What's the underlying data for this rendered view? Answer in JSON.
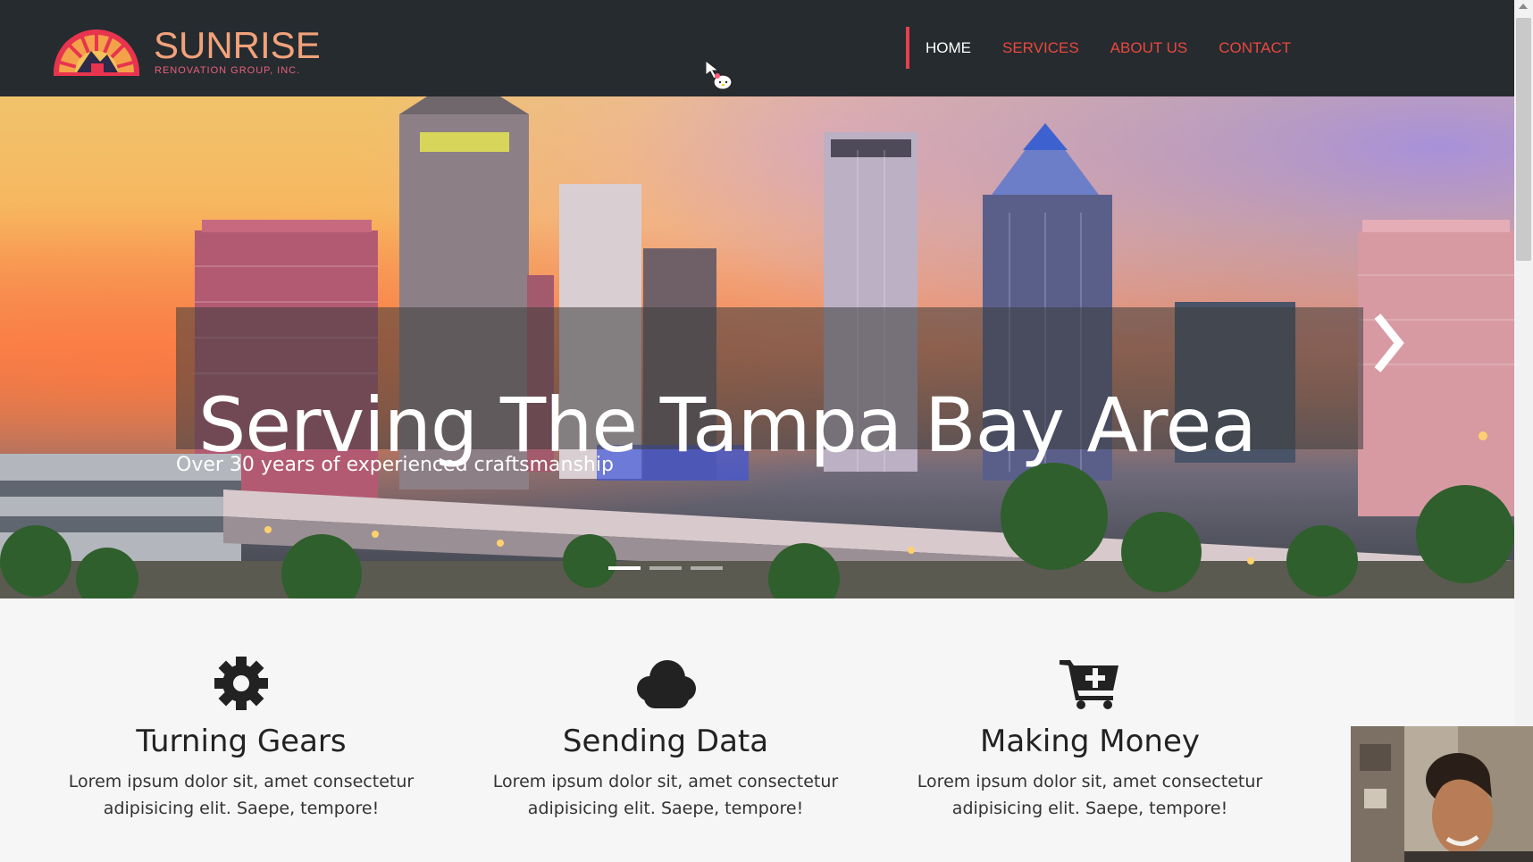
{
  "brand": {
    "name": "SUNRISE",
    "tagline": "RENOVATION GROUP, INC."
  },
  "nav": {
    "items": [
      {
        "label": "HOME",
        "active": true
      },
      {
        "label": "SERVICES",
        "active": false
      },
      {
        "label": "ABOUT US",
        "active": false
      },
      {
        "label": "CONTACT",
        "active": false
      }
    ]
  },
  "hero": {
    "title": "Serving The Tampa Bay Area",
    "subtitle": "Over 30 years of experienced craftsmanship",
    "next_icon": "chevron-right-icon",
    "slides": 3,
    "active_slide": 1
  },
  "features": [
    {
      "icon": "gear-icon",
      "title": "Turning Gears",
      "text_line1": "Lorem ipsum dolor sit, amet consectetur",
      "text_line2": "adipisicing elit. Saepe, tempore!"
    },
    {
      "icon": "cloud-icon",
      "title": "Sending Data",
      "text_line1": "Lorem ipsum dolor sit, amet consectetur",
      "text_line2": "adipisicing elit. Saepe, tempore!"
    },
    {
      "icon": "cart-plus-icon",
      "title": "Making Money",
      "text_line1": "Lorem ipsum dolor sit, amet consectetur",
      "text_line2": "adipisicing elit. Saepe, tempore!"
    }
  ],
  "colors": {
    "navbar_bg": "#262b2f",
    "accent": "#e8483e",
    "brand_orange": "#f2a27a",
    "divider": "#e5404e"
  }
}
